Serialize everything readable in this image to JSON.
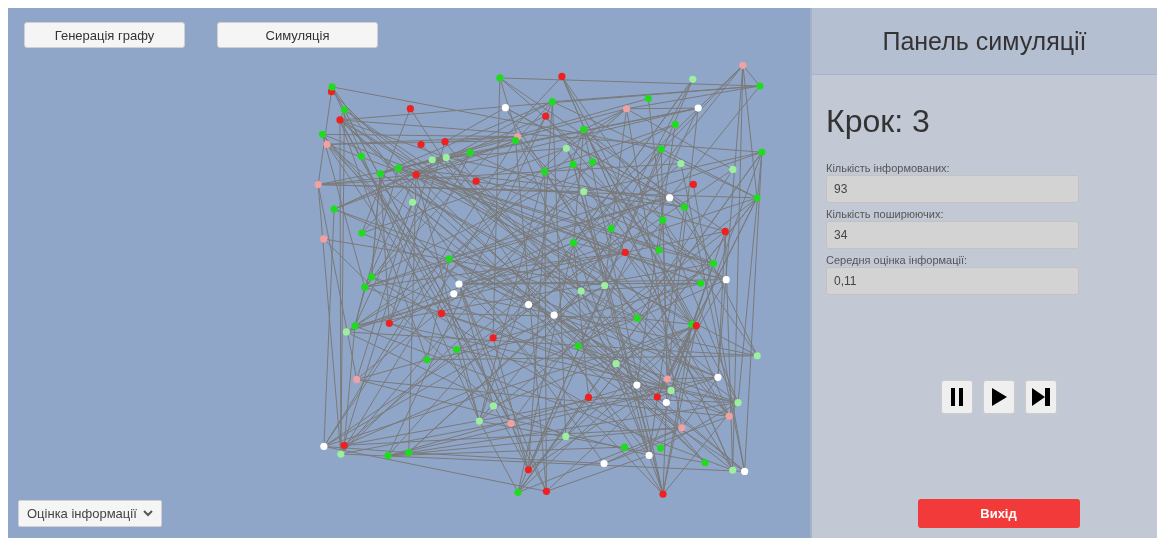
{
  "toolbar": {
    "buttons": [
      "Генерація графу",
      "Симуляція"
    ]
  },
  "dropdown": {
    "value": "Оцінка інформації"
  },
  "panel": {
    "title": "Панель симуляції",
    "step": "Крок: 3",
    "fields": [
      {
        "label": "Кількість інформованих:",
        "value": "93"
      },
      {
        "label": "Кількість поширюючих:",
        "value": "34"
      },
      {
        "label": "Середня оцінка інформації:",
        "value": "0,11"
      }
    ],
    "controls": [
      {
        "kind": "pause"
      },
      {
        "kind": "play"
      },
      {
        "kind": "step"
      }
    ],
    "exit_button": "Вихід"
  }
}
